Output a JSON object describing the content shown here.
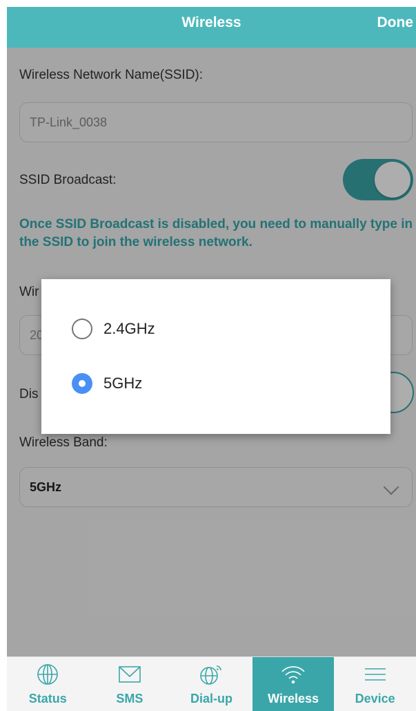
{
  "header": {
    "title": "Wireless",
    "done_label": "Done"
  },
  "form": {
    "ssid_label": "Wireless Network Name(SSID):",
    "ssid_value": "TP-Link_0038",
    "broadcast_label": "SSID Broadcast:",
    "broadcast_on": true,
    "notice": "Once SSID Broadcast is disabled, you need to manually type in the SSID to join the wireless network.",
    "partial_label_1": "Wir",
    "partial_value_2": "20",
    "partial_label_3": "Dis",
    "band_label": "Wireless Band:",
    "band_value": "5GHz"
  },
  "dialog": {
    "options": [
      {
        "label": "2.4GHz",
        "selected": false
      },
      {
        "label": "5GHz",
        "selected": true
      }
    ]
  },
  "tabs": [
    {
      "label": "Status",
      "icon": "globe-icon",
      "active": false
    },
    {
      "label": "SMS",
      "icon": "envelope-icon",
      "active": false
    },
    {
      "label": "Dial-up",
      "icon": "globe-signal-icon",
      "active": false
    },
    {
      "label": "Wireless",
      "icon": "wifi-icon",
      "active": true
    },
    {
      "label": "Device",
      "icon": "menu-icon",
      "active": false
    }
  ],
  "colors": {
    "accent": "#3aa6a9",
    "header": "#4db8bb",
    "radio_selected": "#4a8ff5"
  }
}
